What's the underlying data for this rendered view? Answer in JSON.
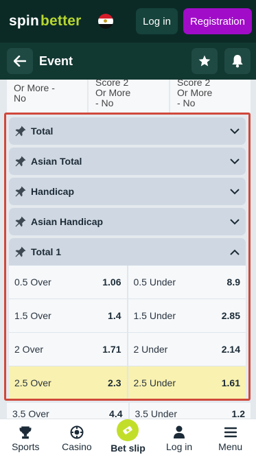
{
  "header": {
    "logo_part1": "spin",
    "logo_part2": "better",
    "login_label": "Log in",
    "register_label": "Registration"
  },
  "subheader": {
    "title": "Event"
  },
  "partial_row": [
    {
      "line1": "Or More -",
      "line2": "No"
    },
    {
      "line0": "Score 2",
      "line1": "Or More",
      "line2": "- No"
    },
    {
      "line0": "Score 2",
      "line1": "Or More",
      "line2": "- No"
    }
  ],
  "markets": [
    {
      "name": "Total",
      "expanded": false
    },
    {
      "name": "Asian Total",
      "expanded": false
    },
    {
      "name": "Handicap",
      "expanded": false
    },
    {
      "name": "Asian Handicap",
      "expanded": false
    },
    {
      "name": "Total 1",
      "expanded": true
    }
  ],
  "total1_odds": [
    {
      "label": "0.5 Over",
      "value": "1.06"
    },
    {
      "label": "0.5 Under",
      "value": "8.9"
    },
    {
      "label": "1.5 Over",
      "value": "1.4"
    },
    {
      "label": "1.5 Under",
      "value": "2.85"
    },
    {
      "label": "2 Over",
      "value": "1.71"
    },
    {
      "label": "2 Under",
      "value": "2.14"
    },
    {
      "label": "2.5 Over",
      "value": "2.3"
    },
    {
      "label": "2.5 Under",
      "value": "1.61"
    }
  ],
  "below_row": [
    {
      "label": "3.5 Over",
      "value": "4.4"
    },
    {
      "label": "3.5 Under",
      "value": "1.2"
    }
  ],
  "bottom_nav": [
    {
      "label": "Sports",
      "icon": "trophy-icon"
    },
    {
      "label": "Casino",
      "icon": "casino-chip-icon"
    },
    {
      "label": "Bet slip",
      "icon": "ticket-icon"
    },
    {
      "label": "Log in",
      "icon": "user-icon"
    },
    {
      "label": "Menu",
      "icon": "menu-icon"
    }
  ],
  "colors": {
    "header_bg": "#0b2a26",
    "register_bg": "#a10cc9",
    "accent_green": "#c3de2a",
    "highlight_row": "#f9f1b0",
    "selection_border": "#d0483a"
  }
}
